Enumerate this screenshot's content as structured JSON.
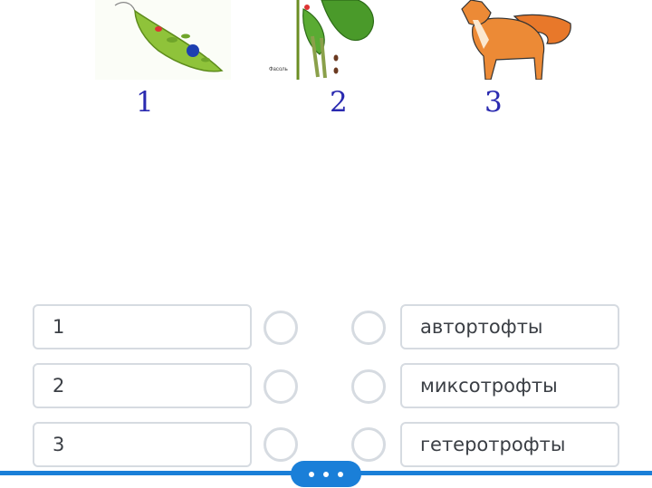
{
  "figures": [
    {
      "number": "1",
      "icon": "euglena-icon"
    },
    {
      "number": "2",
      "icon": "bean-plant-icon",
      "caption": "Фасоль"
    },
    {
      "number": "3",
      "icon": "fox-icon"
    }
  ],
  "matching": {
    "left": [
      "1",
      "2",
      "3"
    ],
    "right": [
      "автортофты",
      "миксотрофты",
      "гетеротрофты"
    ]
  },
  "colors": {
    "accent": "#1a7fd8",
    "number_color": "#2a2ab0",
    "box_border": "#d6dbe1"
  },
  "drag_handle": {
    "icon": "more-dots-icon"
  }
}
